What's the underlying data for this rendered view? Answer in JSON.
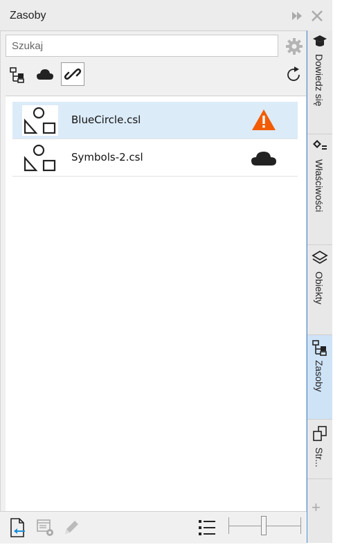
{
  "panel": {
    "title": "Zasoby",
    "search": {
      "value": "",
      "placeholder": "Szukaj"
    },
    "toolbar": {
      "tools": [
        {
          "icon": "hierarchy-icon"
        },
        {
          "icon": "cloud-icon"
        },
        {
          "icon": "link-icon",
          "active": true
        }
      ],
      "refresh_icon": "refresh-icon",
      "settings_icon": "gear-icon"
    },
    "items": [
      {
        "label": "BlueCircle.csl",
        "status_icon": "warning-icon",
        "status_color": "#f25c05",
        "selected": true
      },
      {
        "label": "Symbols-2.csl",
        "status_icon": "cloud-icon",
        "status_color": "#222222",
        "selected": false
      }
    ],
    "bottom": {
      "icons": [
        "import-icon",
        "library-settings-icon",
        "edit-icon",
        "list-view-icon"
      ],
      "zoom_slider": {
        "value": 0.5
      }
    }
  },
  "side_tabs": [
    {
      "label": "Dowiedz się",
      "icon": "graduation-cap-icon",
      "active": false
    },
    {
      "label": "Właściwości",
      "icon": "properties-icon",
      "active": false
    },
    {
      "label": "Obiekty",
      "icon": "layers-icon",
      "active": false
    },
    {
      "label": "Zasoby",
      "icon": "hierarchy-icon",
      "active": true
    },
    {
      "label": "Str...",
      "icon": "pages-icon",
      "active": false
    }
  ],
  "colors": {
    "accent": "#4a90d9",
    "selection": "#dcebf8",
    "warning": "#f25c05"
  }
}
